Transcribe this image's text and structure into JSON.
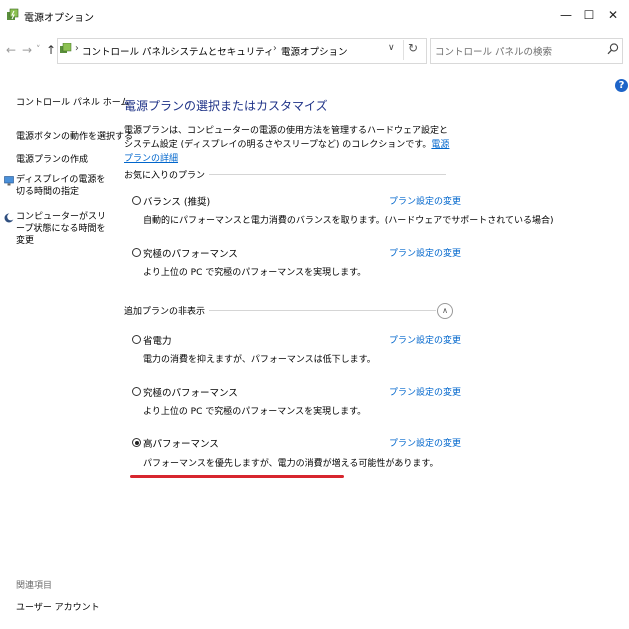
{
  "window": {
    "title": "電源オプション",
    "minimize": "—",
    "maximize": "☐",
    "close": "✕"
  },
  "nav": {
    "back": "←",
    "forward": "→",
    "recent": "˅",
    "up": "↑"
  },
  "address": {
    "crumbs": [
      "コントロール パネル",
      "システムとセキュリティ",
      "電源オプション"
    ],
    "separator": "›",
    "dropdown": "∨",
    "refresh": "↻"
  },
  "search": {
    "placeholder": "コントロール パネルの検索"
  },
  "help": "?",
  "sidebar": {
    "home": "コントロール パネル ホーム",
    "items": [
      "電源ボタンの動作を選択する",
      "電源プランの作成",
      "ディスプレイの電源を切る時間の指定",
      "コンピューターがスリープ状態になる時間を変更"
    ],
    "see_also_label": "関連項目",
    "see_also_items": [
      "ユーザー アカウント"
    ]
  },
  "main": {
    "title": "電源プランの選択またはカスタマイズ",
    "intro_text": "電源プランは、コンピューターの電源の使用方法を管理するハードウェア設定とシステム設定 (ディスプレイの明るさやスリープなど) のコレクションです。",
    "intro_link": "電源プランの詳細",
    "favorites_header": "お気に入りのプラン",
    "additional_header": "追加プランの非表示",
    "collapse_icon": "∧",
    "change_link_label": "プラン設定の変更",
    "favorite_plans": [
      {
        "name": "バランス (推奨)",
        "desc": "自動的にパフォーマンスと電力消費のバランスを取ります。(ハードウェアでサポートされている場合)",
        "selected": false
      },
      {
        "name": "究極のパフォーマンス",
        "desc": "より上位の PC で究極のパフォーマンスを実現します。",
        "selected": false
      }
    ],
    "additional_plans": [
      {
        "name": "省電力",
        "desc": "電力の消費を抑えますが、パフォーマンスは低下します。",
        "selected": false
      },
      {
        "name": "究極のパフォーマンス",
        "desc": "より上位の PC で究極のパフォーマンスを実現します。",
        "selected": false
      },
      {
        "name": "高パフォーマンス",
        "desc": "パフォーマンスを優先しますが、電力の消費が増える可能性があります。",
        "selected": true
      }
    ]
  },
  "colors": {
    "title_blue": "#1e3287",
    "link_blue": "#0066cc",
    "highlight_red": "#d7262e",
    "help_blue": "#1e64c8"
  }
}
